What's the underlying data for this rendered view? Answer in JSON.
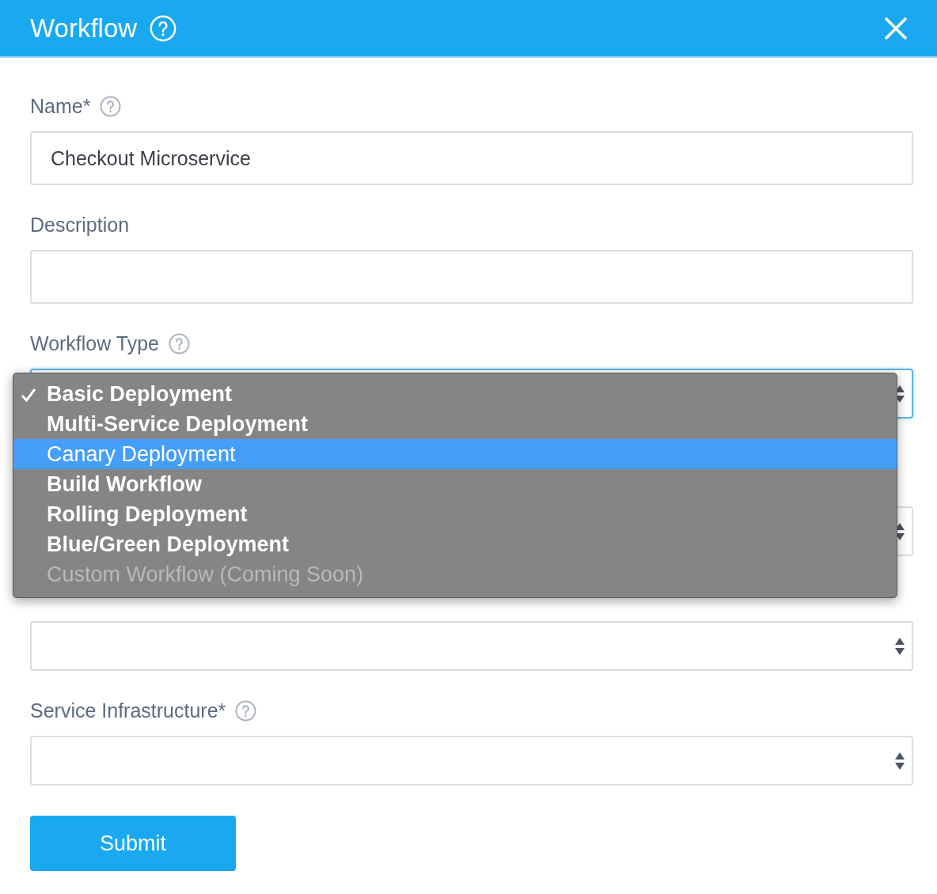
{
  "header": {
    "title": "Workflow"
  },
  "fields": [
    {
      "kind": "text",
      "label": "Name*",
      "help": true,
      "value": "Checkout Microservice"
    },
    {
      "kind": "text",
      "label": "Description",
      "help": false
    },
    {
      "kind": "select",
      "label": "Workflow Type",
      "help": true,
      "focused": true
    },
    {
      "kind": "select",
      "focused": false
    },
    {
      "kind": "select",
      "focused": false
    },
    {
      "kind": "select",
      "label": "Service Infrastructure*",
      "help": true,
      "focused": false
    }
  ],
  "menu": {
    "options": [
      {
        "label": "Basic Deployment",
        "checked": true,
        "selected": false,
        "disabled": false
      },
      {
        "label": "Multi-Service Deployment",
        "checked": false,
        "selected": false,
        "disabled": false
      },
      {
        "label": "Canary Deployment",
        "checked": false,
        "selected": true,
        "disabled": false
      },
      {
        "label": "Build Workflow",
        "checked": false,
        "selected": false,
        "disabled": false
      },
      {
        "label": "Rolling Deployment",
        "checked": false,
        "selected": false,
        "disabled": false
      },
      {
        "label": "Blue/Green Deployment",
        "checked": false,
        "selected": false,
        "disabled": false
      },
      {
        "label": "Custom Workflow (Coming Soon)",
        "checked": false,
        "selected": false,
        "disabled": true
      }
    ]
  },
  "submit": {
    "label": "Submit"
  }
}
